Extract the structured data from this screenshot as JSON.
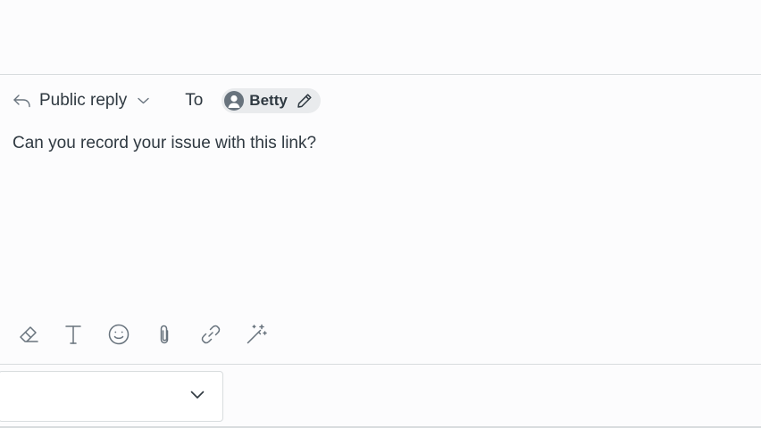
{
  "composer": {
    "reply_type": "Public reply",
    "to_label": "To",
    "recipient": "Betty",
    "message": "Can you record your issue with this link?"
  },
  "toolbar": {
    "tools": [
      "eraser-icon",
      "text-format-icon",
      "emoji-icon",
      "attachment-icon",
      "link-icon",
      "magic-wand-icon"
    ]
  },
  "footer": {
    "select_value": ""
  },
  "colors": {
    "text": "#2f3941",
    "icon": "#68737d",
    "pill_bg": "#e9ebed",
    "divider": "#d8dcde",
    "background": "#fcfcfd"
  }
}
